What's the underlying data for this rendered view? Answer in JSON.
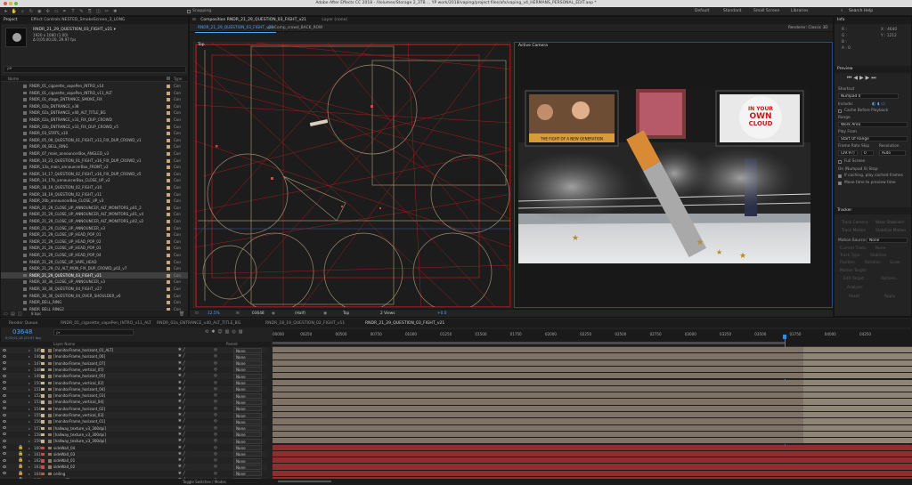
{
  "title": "Adobe After Effects CC 2018 - /Volumes/Storage 2_3TB ... YP work/2018/vaping/project files/afx/vaping_v4_HERMANS_PERSONAL_EDIT.aep *",
  "toolbar": {
    "snapping_label": "Snapping",
    "workspaces": [
      "Default",
      "Standard",
      "Small Screen",
      "Libraries"
    ],
    "search_placeholder": "Search Help"
  },
  "project_panel": {
    "tab_project": "Project",
    "tab_effect_controls": "Effect Controls NESTED_SmokeScreen_3_LONG",
    "selected_name": "RNDR_21_29_QUESTION_03_FIGHT_v21 ▾",
    "selected_info1": "1920 x 1080 (1.00)",
    "selected_info2": "Δ 0;05;00;20, 29.97 fps",
    "search_placeholder": "ρ▾",
    "col_name": "Name",
    "col_type": "Type",
    "items": [
      "RNDR_01_cigarette_vapePen_INTRO_v14",
      "RNDR_01_cigarette_vapePen_INTRO_v11_ALT",
      "RNDR_01_stage_ENTRANCE_SMOKE_FIX",
      "RNDR_02a_ENTRANCE_v38",
      "RNDR_02a_ENTRANCE_v40_ALT_TITLE_BG",
      "RNDR_02a_ENTRANCE_v33_FIX_DUP_CROWD",
      "RNDR_02b_ENTRANCE_v33_FIX_DUP_CROWD_v5",
      "RNDR_03_STATS_v10",
      "RNDR_05_09_QUESTION_01_FIGHT_v13_FIX_DUP_CROWD_v1",
      "RNDR_06_BELL_RING",
      "RNDR_07_main_announcerBox_ANGLED_v3",
      "RNDR_10_23_QUESTION_01_FIGHT_v16_FIX_DUP_CROWD_v1",
      "RNDR_13a_main_announcerBox_FRONT_v2",
      "RNDR_14_17_QUESTION_02_FIGHT_v16_FIX_DUP_CROWD_v5",
      "RNDR_14_17b_announcerBox_CLOSE_UP_v2",
      "RNDR_18_19_QUESTION_02_FIGHT_v10",
      "RNDR_18_19_QUESTION_02_FIGHT_v11",
      "RNDR_20b_announcerBox_CLOSE_UP_v3",
      "RNDR_21_29_CLOSE_UP_ANNOUNCER_ALT_MONITORS_p01_2",
      "RNDR_21_29_CLOSE_UP_ANNOUNCER_ALT_MONITORS_p01_v4",
      "RNDR_21_29_CLOSE_UP_ANNOUNCER_ALT_MONITORS_p02_v2",
      "RNDR_21_29_CLOSE_UP_ANNOUNCER_v3",
      "RNDR_21_29_CLOSE_UP_HEAD_POP_01",
      "RNDR_21_29_CLOSE_UP_HEAD_POP_02",
      "RNDR_21_29_CLOSE_UP_HEAD_POP_03",
      "RNDR_21_29_CLOSE_UP_HEAD_POP_04",
      "RNDR_21_29_CLOSE_UP_VAPE_HEAD",
      "RNDR_21_29_CU_ALT_MON_FIX_DUP_CROWD_p02_v7",
      "RNDR_21_29_QUESTION_03_FIGHT_v21",
      "RNDR_30_36_CLOSE_UP_ANNOUNCER_v3",
      "RNDR_30_36_QUESTION_04_FIGHT_v27",
      "RNDR_30_36_QUESTION_04_OVER_SHOULDER_v6",
      "RNDR_BELL_RING",
      "RNDR_BELL_RING2",
      "RNDR_rings_HIGHLIGHT"
    ],
    "selected_index": 28,
    "type_label": "Con",
    "footer_bpc": "8 bpc"
  },
  "composition_panel": {
    "tab_label": "Composition RNDR_21_29_QUESTION_03_FIGHT_v21",
    "layer_tab": "Layer (none)",
    "subtab_1": "RNDR_21_29_QUESTION_03_FIGHT_v21",
    "subtab_2": "preComp_crowd_BACK_ROW",
    "renderer": "Renderer:  Classic 3D",
    "view_top": "Top",
    "view_active": "Active Camera",
    "zoom": "12.5%",
    "timecode": "03648",
    "resolution": "(Half)",
    "view_select": "Top",
    "views": "2 Views",
    "exposure": "+0.0"
  },
  "info_panel": {
    "title": "Info",
    "r": "R :",
    "g": "G :",
    "b": "B :",
    "a": "A : 0",
    "x": "X : 4640",
    "y": "Y : 1212"
  },
  "preview_panel": {
    "title": "Preview",
    "shortcut_label": "Shortcut",
    "shortcut_value": "Numpad 0",
    "include_label": "Include:",
    "cache_label": "Cache Before Playback",
    "range_label": "Range",
    "range_value": "Work Area",
    "playfrom_label": "Play From",
    "playfrom_value": "Start Of Range",
    "framerate_label": "Frame Rate",
    "skip_label": "Skip",
    "resolution_label": "Resolution",
    "framerate_value": "(29.97)",
    "skip_value": "0",
    "resolution_value": "Auto",
    "fullscreen_label": "Full Screen",
    "onstop_label": "On (Numpad 0) Stop:",
    "ifcaching_label": "If caching, play cached frames",
    "movetime_label": "Move time to preview time"
  },
  "tracker_panel": {
    "title": "Tracker",
    "track_camera": "Track Camera",
    "warp_stabilizer": "Warp Stabilizer",
    "track_motion": "Track Motion",
    "stabilize_motion": "Stabilize Motion",
    "motion_source_label": "Motion Source:",
    "motion_source_value": "None",
    "current_track_label": "Current Track:",
    "current_track_value": "None",
    "track_type_label": "Track Type:",
    "track_type_value": "Stabilize",
    "position": "Position",
    "rotation": "Rotation",
    "scale": "Scale",
    "motion_target": "Motion Target:",
    "edit_target": "Edit Target...",
    "options": "Options...",
    "analyze_label": "Analyze:",
    "reset": "Reset",
    "apply": "Apply"
  },
  "timeline": {
    "tab_render_queue": "Render Queue",
    "tabs": [
      "RNDR_01_cigarette_vapePen_INTRO_v11_ALT",
      "RNDR_02a_ENTRANCE_v40_ALT_TITLE_BG",
      "RNDR_18_19_QUESTION_02_FIGHT_v11",
      "RNDR_21_29_QUESTION_03_FIGHT_v21"
    ],
    "timecode": "03648",
    "timecode_sub": "0;02;01;18 (29.97 fps)",
    "col_layer_name": "Layer Name",
    "col_parent": "Parent",
    "ruler": [
      "00000",
      "00250",
      "00500",
      "00750",
      "01000",
      "01250",
      "01500",
      "01750",
      "02000",
      "02250",
      "02500",
      "02750",
      "03000",
      "03250",
      "03500",
      "03750",
      "04000",
      "04250"
    ],
    "layers": [
      {
        "num": "145",
        "name": "[monitorFrame_horizont_01_ALT]",
        "parent": "None",
        "color": "#c9b58f"
      },
      {
        "num": "146",
        "name": "[monitorFrame_horizont_06]",
        "parent": "None",
        "color": "#c9b58f"
      },
      {
        "num": "147",
        "name": "[monitorFrame_horizont_07]",
        "parent": "None",
        "color": "#c9b58f"
      },
      {
        "num": "148",
        "name": "[monitorFrame_vertical_05]",
        "parent": "None",
        "color": "#c9b58f"
      },
      {
        "num": "149",
        "name": "[monitorFrame_horizont_05]",
        "parent": "None",
        "color": "#c9b58f"
      },
      {
        "num": "150",
        "name": "[monitorFrame_vertical_02]",
        "parent": "None",
        "color": "#c9b58f"
      },
      {
        "num": "151",
        "name": "[monitorFrame_horizont_04]",
        "parent": "None",
        "color": "#c9b58f"
      },
      {
        "num": "152",
        "name": "[monitorFrame_horizont_03]",
        "parent": "None",
        "color": "#c9b58f"
      },
      {
        "num": "153",
        "name": "[monitorFrame_vertical_04]",
        "parent": "None",
        "color": "#c9b58f"
      },
      {
        "num": "154",
        "name": "[monitorFrame_horizont_02]",
        "parent": "None",
        "color": "#c9b58f"
      },
      {
        "num": "155",
        "name": "[monitorFrame_vertical_03]",
        "parent": "None",
        "color": "#c9b58f"
      },
      {
        "num": "156",
        "name": "[monitorFrame_horizont_01]",
        "parent": "None",
        "color": "#c9b58f"
      },
      {
        "num": "157",
        "name": "[hallway_texture_v3_300dpi]",
        "parent": "None",
        "color": "#c9b58f"
      },
      {
        "num": "158",
        "name": "[hallway_texture_v3_300dpi]",
        "parent": "None",
        "color": "#c9b58f"
      },
      {
        "num": "159",
        "name": "[hallway_texture_v3_300dpi]",
        "parent": "None",
        "color": "#c9b58f"
      },
      {
        "num": "160",
        "name": "sideWall_04",
        "parent": "None",
        "color": "#d04848"
      },
      {
        "num": "161",
        "name": "sideWall_03",
        "parent": "None",
        "color": "#d04848"
      },
      {
        "num": "162",
        "name": "sideWall_01",
        "parent": "None",
        "color": "#d04848"
      },
      {
        "num": "163",
        "name": "sideWall_02",
        "parent": "None",
        "color": "#d04848"
      },
      {
        "num": "164",
        "name": "ceiling",
        "parent": "None",
        "color": "#d04848"
      },
      {
        "num": "165",
        "name": "groundFloor",
        "parent": "None",
        "color": "#d04848"
      }
    ],
    "footer_label": "Toggle Switches / Modes"
  },
  "viewer_monitors": {
    "monitor_2_text": "THE FIGHT OF A NEW GENERATION",
    "monitor_3_line1": "IN YOUR",
    "monitor_3_line2": "OWN",
    "monitor_3_line3": "CLOUD"
  },
  "colors": {
    "accent_blue": "#2d8ceb",
    "label_sand": "#c9b58f",
    "label_red": "#d04848",
    "top_view_line": "#c41e1e"
  }
}
